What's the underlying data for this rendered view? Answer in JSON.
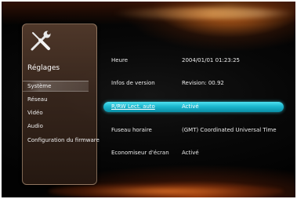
{
  "sidebar": {
    "title": "Réglages",
    "items": [
      {
        "label": "Système",
        "selected": true
      },
      {
        "label": "Réseau",
        "selected": false
      },
      {
        "label": "Vidéo",
        "selected": false
      },
      {
        "label": "Audio",
        "selected": false
      },
      {
        "label": "Configuration du firmware",
        "selected": false
      }
    ]
  },
  "settings": {
    "rows": [
      {
        "label": "Heure",
        "value": "2004/01/01 01:23:25"
      },
      {
        "label": "Infos de version",
        "value": "Revision: 00.92"
      },
      {
        "label": "R/RW Lect. auto",
        "value": "Activé",
        "highlighted": true
      },
      {
        "label": "Fuseau horaire",
        "value": "(GMT) Coordinated Universal Time"
      },
      {
        "label": "Economiseur d'écran",
        "value": "Activé"
      }
    ]
  },
  "colors": {
    "highlight": "#1cb8cf",
    "glow": "#e87a28",
    "background": "#070707"
  },
  "icons": {
    "sidebar_header": "tools-icon"
  }
}
